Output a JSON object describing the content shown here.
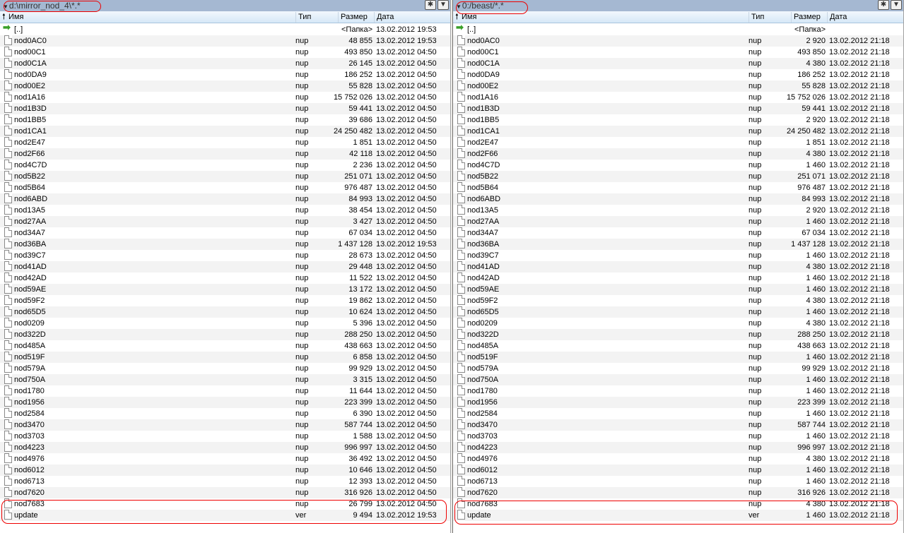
{
  "columns": {
    "name": "Имя",
    "ext": "Тип",
    "size": "Размер",
    "date": "Дата"
  },
  "left": {
    "path": "d:\\mirror_nod_4\\*.*",
    "parent": {
      "name": "[..]",
      "size": "<Папка>",
      "date": "13.02.2012 19:53"
    },
    "files": [
      {
        "name": "nod0AC0",
        "ext": "nup",
        "size": "48 855",
        "date": "13.02.2012 19:53"
      },
      {
        "name": "nod00C1",
        "ext": "nup",
        "size": "493 850",
        "date": "13.02.2012 04:50"
      },
      {
        "name": "nod0C1A",
        "ext": "nup",
        "size": "26 145",
        "date": "13.02.2012 04:50"
      },
      {
        "name": "nod0DA9",
        "ext": "nup",
        "size": "186 252",
        "date": "13.02.2012 04:50"
      },
      {
        "name": "nod00E2",
        "ext": "nup",
        "size": "55 828",
        "date": "13.02.2012 04:50"
      },
      {
        "name": "nod1A16",
        "ext": "nup",
        "size": "15 752 026",
        "date": "13.02.2012 04:50"
      },
      {
        "name": "nod1B3D",
        "ext": "nup",
        "size": "59 441",
        "date": "13.02.2012 04:50"
      },
      {
        "name": "nod1BB5",
        "ext": "nup",
        "size": "39 686",
        "date": "13.02.2012 04:50"
      },
      {
        "name": "nod1CA1",
        "ext": "nup",
        "size": "24 250 482",
        "date": "13.02.2012 04:50"
      },
      {
        "name": "nod2E47",
        "ext": "nup",
        "size": "1 851",
        "date": "13.02.2012 04:50"
      },
      {
        "name": "nod2F66",
        "ext": "nup",
        "size": "42 118",
        "date": "13.02.2012 04:50"
      },
      {
        "name": "nod4C7D",
        "ext": "nup",
        "size": "2 236",
        "date": "13.02.2012 04:50"
      },
      {
        "name": "nod5B22",
        "ext": "nup",
        "size": "251 071",
        "date": "13.02.2012 04:50"
      },
      {
        "name": "nod5B64",
        "ext": "nup",
        "size": "976 487",
        "date": "13.02.2012 04:50"
      },
      {
        "name": "nod6ABD",
        "ext": "nup",
        "size": "84 993",
        "date": "13.02.2012 04:50"
      },
      {
        "name": "nod13A5",
        "ext": "nup",
        "size": "38 454",
        "date": "13.02.2012 04:50"
      },
      {
        "name": "nod27AA",
        "ext": "nup",
        "size": "3 427",
        "date": "13.02.2012 04:50"
      },
      {
        "name": "nod34A7",
        "ext": "nup",
        "size": "67 034",
        "date": "13.02.2012 04:50"
      },
      {
        "name": "nod36BA",
        "ext": "nup",
        "size": "1 437 128",
        "date": "13.02.2012 19:53"
      },
      {
        "name": "nod39C7",
        "ext": "nup",
        "size": "28 673",
        "date": "13.02.2012 04:50"
      },
      {
        "name": "nod41AD",
        "ext": "nup",
        "size": "29 448",
        "date": "13.02.2012 04:50"
      },
      {
        "name": "nod42AD",
        "ext": "nup",
        "size": "11 522",
        "date": "13.02.2012 04:50"
      },
      {
        "name": "nod59AE",
        "ext": "nup",
        "size": "13 172",
        "date": "13.02.2012 04:50"
      },
      {
        "name": "nod59F2",
        "ext": "nup",
        "size": "19 862",
        "date": "13.02.2012 04:50"
      },
      {
        "name": "nod65D5",
        "ext": "nup",
        "size": "10 624",
        "date": "13.02.2012 04:50"
      },
      {
        "name": "nod0209",
        "ext": "nup",
        "size": "5 396",
        "date": "13.02.2012 04:50"
      },
      {
        "name": "nod322D",
        "ext": "nup",
        "size": "288 250",
        "date": "13.02.2012 04:50"
      },
      {
        "name": "nod485A",
        "ext": "nup",
        "size": "438 663",
        "date": "13.02.2012 04:50"
      },
      {
        "name": "nod519F",
        "ext": "nup",
        "size": "6 858",
        "date": "13.02.2012 04:50"
      },
      {
        "name": "nod579A",
        "ext": "nup",
        "size": "99 929",
        "date": "13.02.2012 04:50"
      },
      {
        "name": "nod750A",
        "ext": "nup",
        "size": "3 315",
        "date": "13.02.2012 04:50"
      },
      {
        "name": "nod1780",
        "ext": "nup",
        "size": "11 644",
        "date": "13.02.2012 04:50"
      },
      {
        "name": "nod1956",
        "ext": "nup",
        "size": "223 399",
        "date": "13.02.2012 04:50"
      },
      {
        "name": "nod2584",
        "ext": "nup",
        "size": "6 390",
        "date": "13.02.2012 04:50"
      },
      {
        "name": "nod3470",
        "ext": "nup",
        "size": "587 744",
        "date": "13.02.2012 04:50"
      },
      {
        "name": "nod3703",
        "ext": "nup",
        "size": "1 588",
        "date": "13.02.2012 04:50"
      },
      {
        "name": "nod4223",
        "ext": "nup",
        "size": "996 997",
        "date": "13.02.2012 04:50"
      },
      {
        "name": "nod4976",
        "ext": "nup",
        "size": "36 492",
        "date": "13.02.2012 04:50"
      },
      {
        "name": "nod6012",
        "ext": "nup",
        "size": "10 646",
        "date": "13.02.2012 04:50"
      },
      {
        "name": "nod6713",
        "ext": "nup",
        "size": "12 393",
        "date": "13.02.2012 04:50"
      },
      {
        "name": "nod7620",
        "ext": "nup",
        "size": "316 926",
        "date": "13.02.2012 04:50"
      },
      {
        "name": "nod7683",
        "ext": "nup",
        "size": "26 799",
        "date": "13.02.2012 04:50"
      },
      {
        "name": "update",
        "ext": "ver",
        "size": "9 494",
        "date": "13.02.2012 19:53"
      }
    ]
  },
  "right": {
    "path": "0:/beast/*.*",
    "parent": {
      "name": "[..]",
      "size": "<Папка>",
      "date": ""
    },
    "files": [
      {
        "name": "nod0AC0",
        "ext": "nup",
        "size": "2 920",
        "date": "13.02.2012 21:18"
      },
      {
        "name": "nod00C1",
        "ext": "nup",
        "size": "493 850",
        "date": "13.02.2012 21:18"
      },
      {
        "name": "nod0C1A",
        "ext": "nup",
        "size": "4 380",
        "date": "13.02.2012 21:18"
      },
      {
        "name": "nod0DA9",
        "ext": "nup",
        "size": "186 252",
        "date": "13.02.2012 21:18"
      },
      {
        "name": "nod00E2",
        "ext": "nup",
        "size": "55 828",
        "date": "13.02.2012 21:18"
      },
      {
        "name": "nod1A16",
        "ext": "nup",
        "size": "15 752 026",
        "date": "13.02.2012 21:18"
      },
      {
        "name": "nod1B3D",
        "ext": "nup",
        "size": "59 441",
        "date": "13.02.2012 21:18"
      },
      {
        "name": "nod1BB5",
        "ext": "nup",
        "size": "2 920",
        "date": "13.02.2012 21:18"
      },
      {
        "name": "nod1CA1",
        "ext": "nup",
        "size": "24 250 482",
        "date": "13.02.2012 21:18"
      },
      {
        "name": "nod2E47",
        "ext": "nup",
        "size": "1 851",
        "date": "13.02.2012 21:18"
      },
      {
        "name": "nod2F66",
        "ext": "nup",
        "size": "4 380",
        "date": "13.02.2012 21:18"
      },
      {
        "name": "nod4C7D",
        "ext": "nup",
        "size": "1 460",
        "date": "13.02.2012 21:18"
      },
      {
        "name": "nod5B22",
        "ext": "nup",
        "size": "251 071",
        "date": "13.02.2012 21:18"
      },
      {
        "name": "nod5B64",
        "ext": "nup",
        "size": "976 487",
        "date": "13.02.2012 21:18"
      },
      {
        "name": "nod6ABD",
        "ext": "nup",
        "size": "84 993",
        "date": "13.02.2012 21:18"
      },
      {
        "name": "nod13A5",
        "ext": "nup",
        "size": "2 920",
        "date": "13.02.2012 21:18"
      },
      {
        "name": "nod27AA",
        "ext": "nup",
        "size": "1 460",
        "date": "13.02.2012 21:18"
      },
      {
        "name": "nod34A7",
        "ext": "nup",
        "size": "67 034",
        "date": "13.02.2012 21:18"
      },
      {
        "name": "nod36BA",
        "ext": "nup",
        "size": "1 437 128",
        "date": "13.02.2012 21:18"
      },
      {
        "name": "nod39C7",
        "ext": "nup",
        "size": "1 460",
        "date": "13.02.2012 21:18"
      },
      {
        "name": "nod41AD",
        "ext": "nup",
        "size": "4 380",
        "date": "13.02.2012 21:18"
      },
      {
        "name": "nod42AD",
        "ext": "nup",
        "size": "1 460",
        "date": "13.02.2012 21:18"
      },
      {
        "name": "nod59AE",
        "ext": "nup",
        "size": "1 460",
        "date": "13.02.2012 21:18"
      },
      {
        "name": "nod59F2",
        "ext": "nup",
        "size": "4 380",
        "date": "13.02.2012 21:18"
      },
      {
        "name": "nod65D5",
        "ext": "nup",
        "size": "1 460",
        "date": "13.02.2012 21:18"
      },
      {
        "name": "nod0209",
        "ext": "nup",
        "size": "4 380",
        "date": "13.02.2012 21:18"
      },
      {
        "name": "nod322D",
        "ext": "nup",
        "size": "288 250",
        "date": "13.02.2012 21:18"
      },
      {
        "name": "nod485A",
        "ext": "nup",
        "size": "438 663",
        "date": "13.02.2012 21:18"
      },
      {
        "name": "nod519F",
        "ext": "nup",
        "size": "1 460",
        "date": "13.02.2012 21:18"
      },
      {
        "name": "nod579A",
        "ext": "nup",
        "size": "99 929",
        "date": "13.02.2012 21:18"
      },
      {
        "name": "nod750A",
        "ext": "nup",
        "size": "1 460",
        "date": "13.02.2012 21:18"
      },
      {
        "name": "nod1780",
        "ext": "nup",
        "size": "1 460",
        "date": "13.02.2012 21:18"
      },
      {
        "name": "nod1956",
        "ext": "nup",
        "size": "223 399",
        "date": "13.02.2012 21:18"
      },
      {
        "name": "nod2584",
        "ext": "nup",
        "size": "1 460",
        "date": "13.02.2012 21:18"
      },
      {
        "name": "nod3470",
        "ext": "nup",
        "size": "587 744",
        "date": "13.02.2012 21:18"
      },
      {
        "name": "nod3703",
        "ext": "nup",
        "size": "1 460",
        "date": "13.02.2012 21:18"
      },
      {
        "name": "nod4223",
        "ext": "nup",
        "size": "996 997",
        "date": "13.02.2012 21:18"
      },
      {
        "name": "nod4976",
        "ext": "nup",
        "size": "4 380",
        "date": "13.02.2012 21:18"
      },
      {
        "name": "nod6012",
        "ext": "nup",
        "size": "1 460",
        "date": "13.02.2012 21:18"
      },
      {
        "name": "nod6713",
        "ext": "nup",
        "size": "1 460",
        "date": "13.02.2012 21:18"
      },
      {
        "name": "nod7620",
        "ext": "nup",
        "size": "316 926",
        "date": "13.02.2012 21:18"
      },
      {
        "name": "nod7683",
        "ext": "nup",
        "size": "4 380",
        "date": "13.02.2012 21:18"
      },
      {
        "name": "update",
        "ext": "ver",
        "size": "1 460",
        "date": "13.02.2012 21:18"
      }
    ]
  },
  "buttons": {
    "favorites": "✱",
    "history": "▼"
  },
  "colors": {
    "pathbar": "#a5b8d2",
    "annotation": "#e00000",
    "parent_arrow": "#3aa02a"
  }
}
